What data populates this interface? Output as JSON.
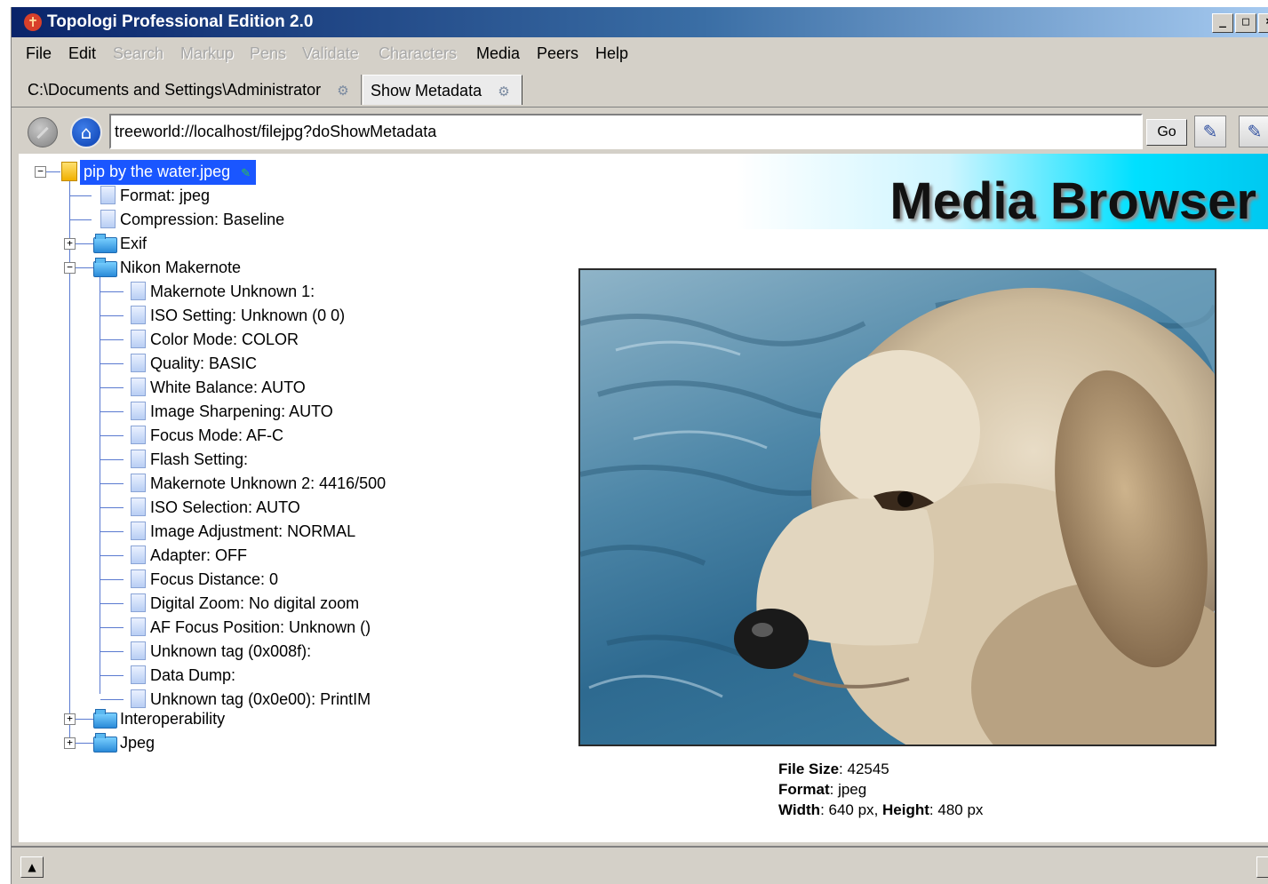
{
  "window": {
    "title": "Topologi Professional Edition 2.0",
    "app_icon": "topologi-app-icon",
    "controls": [
      "minimize",
      "maximize",
      "close"
    ]
  },
  "menubar": {
    "items": [
      {
        "label": "File",
        "enabled": true
      },
      {
        "label": "Edit",
        "enabled": true
      },
      {
        "label": "Search",
        "enabled": false
      },
      {
        "label": "Markup",
        "enabled": false
      },
      {
        "label": "Pens",
        "enabled": false
      },
      {
        "label": "Validate",
        "enabled": false
      },
      {
        "label": "Characters",
        "enabled": false
      },
      {
        "label": "Media",
        "enabled": true
      },
      {
        "label": "Peers",
        "enabled": true
      },
      {
        "label": "Help",
        "enabled": true
      }
    ]
  },
  "tabs": [
    {
      "label": "C:\\Documents and Settings\\Administrator",
      "active": false
    },
    {
      "label": "Show Metadata",
      "active": true
    }
  ],
  "addressbar": {
    "url": "treeworld://localhost/filejpg?doShowMetadata",
    "go_label": "Go"
  },
  "banner": {
    "title": "Media Browser"
  },
  "tree": {
    "root": "pip by the water.jpeg",
    "format": "Format: jpeg",
    "compression": "Compression: Baseline",
    "exif": "Exif",
    "nikon": "Nikon Makernote",
    "nikon_items": [
      "Makernote Unknown 1:",
      "ISO Setting: Unknown (0 0)",
      "Color Mode: COLOR",
      "Quality: BASIC",
      "White Balance: AUTO",
      "Image Sharpening: AUTO",
      "Focus Mode: AF-C",
      "Flash Setting:",
      "Makernote Unknown 2: 4416/500",
      "ISO Selection: AUTO",
      "Image Adjustment: NORMAL",
      "Adapter: OFF",
      "Focus Distance: 0",
      "Digital Zoom: No digital zoom",
      "AF Focus Position: Unknown ()",
      "Unknown tag (0x008f):",
      "Data Dump:",
      "Unknown tag (0x0e00): PrintIM"
    ],
    "interop": "Interoperability",
    "jpeg": "Jpeg"
  },
  "caption": {
    "file_size_label": "File Size",
    "file_size": "42545",
    "format_label": "Format",
    "format": "jpeg",
    "width_label": "Width",
    "width": "640 px",
    "height_label": "Height",
    "height": "480 px"
  },
  "colors": {
    "selection": "#1a56ff",
    "title_bar": "#0a246a",
    "banner_accent": "#00e0ff"
  }
}
